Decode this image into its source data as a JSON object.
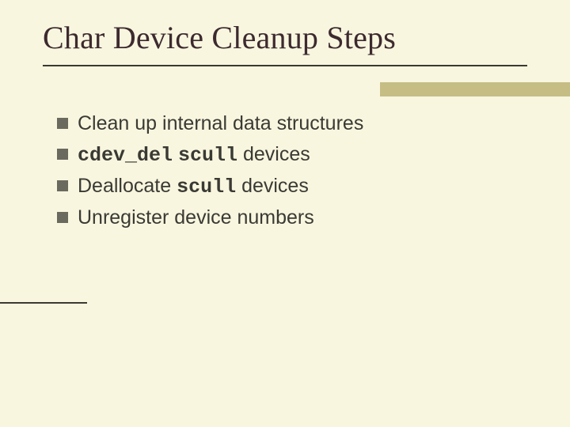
{
  "title": "Char Device Cleanup Steps",
  "bullets": {
    "b0": {
      "text": "Clean up internal data structures"
    },
    "b1": {
      "code1": "cdev_del",
      "code2": "scull",
      "tail": "devices"
    },
    "b2": {
      "pre": "Deallocate",
      "code": "scull",
      "tail": "devices"
    },
    "b3": {
      "text": "Unregister device numbers"
    }
  }
}
